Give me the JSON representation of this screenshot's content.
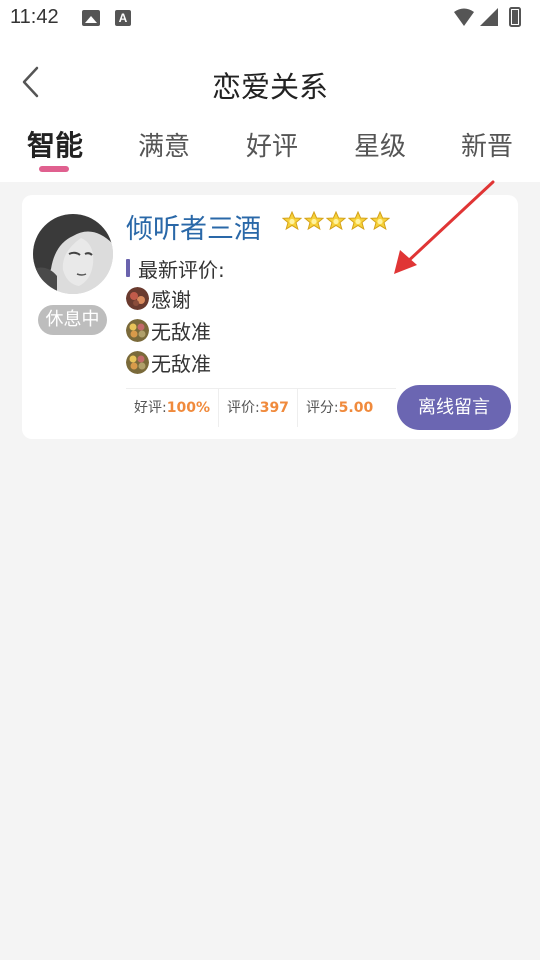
{
  "status_bar": {
    "time": "11:42",
    "a_glyph": "A",
    "icons": [
      "image-icon",
      "text-a-icon",
      "wifi-icon",
      "signal-icon",
      "battery-icon"
    ]
  },
  "header": {
    "title": "恋爱关系",
    "back_icon": "chevron-left-icon"
  },
  "tabs": [
    {
      "label": "智能",
      "active": true
    },
    {
      "label": "满意",
      "active": false
    },
    {
      "label": "好评",
      "active": false
    },
    {
      "label": "星级",
      "active": false
    },
    {
      "label": "新晋",
      "active": false
    }
  ],
  "card": {
    "name": "倾听者三酒",
    "status_badge": "休息中",
    "star_count": 5,
    "review_title": "最新评价:",
    "reviews": [
      {
        "text": "感谢"
      },
      {
        "text": "无敌准"
      },
      {
        "text": "无敌准"
      }
    ],
    "stats": [
      {
        "label": "好评:",
        "value": "100%"
      },
      {
        "label": "评价:",
        "value": "397"
      },
      {
        "label": "评分:",
        "value": "5.00"
      }
    ],
    "offline_button": "离线留言"
  },
  "colors": {
    "accent": "#6b66b2",
    "tab_indicator": "#e0608f",
    "name": "#2a68a8",
    "stat_value": "#f08a3c",
    "annotation_arrow": "#e03535"
  }
}
